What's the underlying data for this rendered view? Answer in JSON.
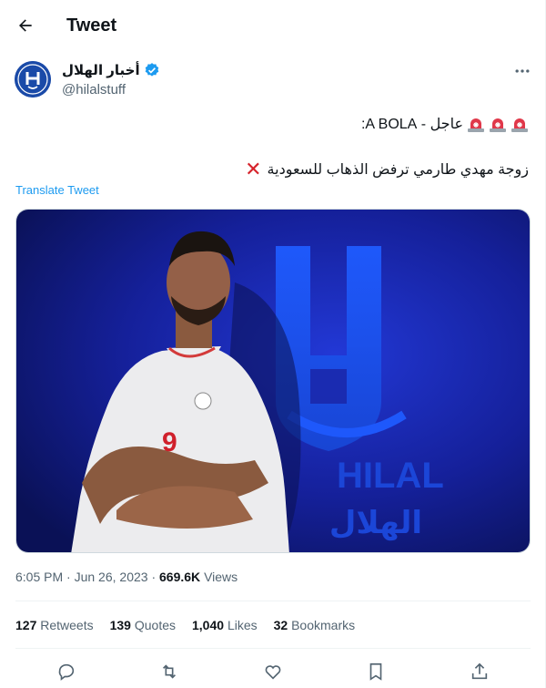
{
  "header": {
    "title": "Tweet"
  },
  "author": {
    "name": "أخبار الهلال",
    "handle": "@hilalstuff",
    "avatar_text": "HILAL"
  },
  "tweet": {
    "line1": "عاجل - A BOLA:",
    "line2": "زوجة مهدي طارمي ترفض الذهاب للسعودية",
    "translate": "Translate Tweet"
  },
  "media": {
    "jersey_number": "9",
    "logo_text_en": "HILAL",
    "logo_text_ar": "الهلال"
  },
  "meta": {
    "time": "6:05 PM",
    "sep1": "·",
    "date": "Jun 26, 2023",
    "sep2": "·",
    "views": "669.6K",
    "views_label": "Views"
  },
  "stats": {
    "retweets": "127",
    "retweets_label": "Retweets",
    "quotes": "139",
    "quotes_label": "Quotes",
    "likes": "1,040",
    "likes_label": "Likes",
    "bookmarks": "32",
    "bookmarks_label": "Bookmarks"
  },
  "colors": {
    "accent": "#1d9bf0",
    "verified": "#1d9bf0",
    "cross": "#d6232b",
    "media_bg": "#1a2bb0"
  }
}
